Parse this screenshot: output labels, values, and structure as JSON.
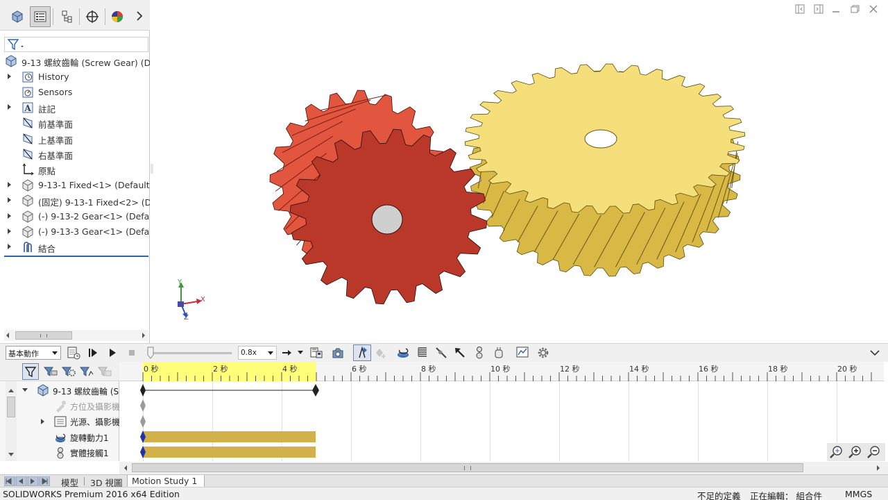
{
  "feature_tree": {
    "root": "9-13 螺紋齒輪 (Screw Gear)  (De",
    "items": [
      {
        "label": "History",
        "expandable": true,
        "icon": "history-icon"
      },
      {
        "label": "Sensors",
        "expandable": false,
        "icon": "sensors-icon"
      },
      {
        "label": "註記",
        "expandable": true,
        "icon": "annotation-icon"
      },
      {
        "label": "前基準面",
        "expandable": false,
        "icon": "plane-icon"
      },
      {
        "label": "上基準面",
        "expandable": false,
        "icon": "plane-icon"
      },
      {
        "label": "右基準面",
        "expandable": false,
        "icon": "plane-icon"
      },
      {
        "label": "原點",
        "expandable": false,
        "icon": "origin-icon"
      },
      {
        "label": "9-13-1 Fixed<1> (Default<",
        "expandable": true,
        "icon": "part-icon"
      },
      {
        "label": "(固定) 9-13-1 Fixed<2> (De",
        "expandable": true,
        "icon": "part-icon"
      },
      {
        "label": "(-) 9-13-2 Gear<1> (Defaul",
        "expandable": true,
        "icon": "part-icon"
      },
      {
        "label": "(-) 9-13-3 Gear<1> (Defaul",
        "expandable": true,
        "icon": "part-icon"
      },
      {
        "label": "結合",
        "expandable": true,
        "icon": "mates-icon"
      }
    ]
  },
  "triad": {
    "x": "X",
    "y": "Y",
    "z": "Z"
  },
  "motion_toolbar": {
    "study_type": "基本動作",
    "playback_speed": "0.8x"
  },
  "motion_tree": {
    "root": "9-13 螺紋齒輪 (S",
    "items": [
      {
        "label": "方位及攝影機",
        "dim": true
      },
      {
        "label": "光源、攝影機",
        "dim": false
      },
      {
        "label": "旋轉動力1",
        "dim": false
      },
      {
        "label": "實體接觸1",
        "dim": false
      }
    ]
  },
  "timeline": {
    "ticks": [
      "0 秒",
      "2 秒",
      "4 秒",
      "6 秒",
      "8 秒",
      "10 秒",
      "12 秒",
      "14 秒",
      "16 秒",
      "18 秒",
      "20 秒"
    ],
    "time_bar_end_seconds": 5
  },
  "bottom_tabs": [
    "模型",
    "3D 視圖",
    "Motion Study 1"
  ],
  "status": {
    "edition": "SOLIDWORKS Premium 2016 x64 Edition",
    "definition": "不足的定義",
    "editing": "正在編輯： 組合件",
    "units": "MMGS"
  },
  "colors": {
    "red_gear": "#b9382a",
    "yellow_gear": "#f5df7a",
    "timeline_highlight": "#ffff7a",
    "time_bar": "#d2b14b",
    "accent": "#2a65b0"
  }
}
